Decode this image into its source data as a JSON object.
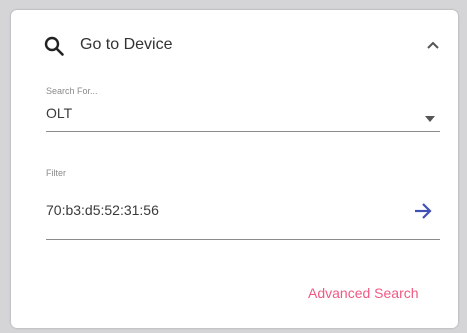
{
  "panel": {
    "title": "Go to Device",
    "header_icon": "search-icon",
    "collapse_icon": "chevron-up-icon"
  },
  "search_for": {
    "label": "Search For...",
    "value": "OLT",
    "dropdown_icon": "caret-down-icon"
  },
  "filter": {
    "label": "Filter",
    "value": "70:b3:d5:52:31:56",
    "go_icon": "arrow-right-icon"
  },
  "advanced_search": {
    "label": "Advanced Search"
  },
  "colors": {
    "accent_link": "#ef5a84",
    "arrow": "#3f51b5",
    "text": "#333333",
    "background": "#d5d5d8"
  }
}
